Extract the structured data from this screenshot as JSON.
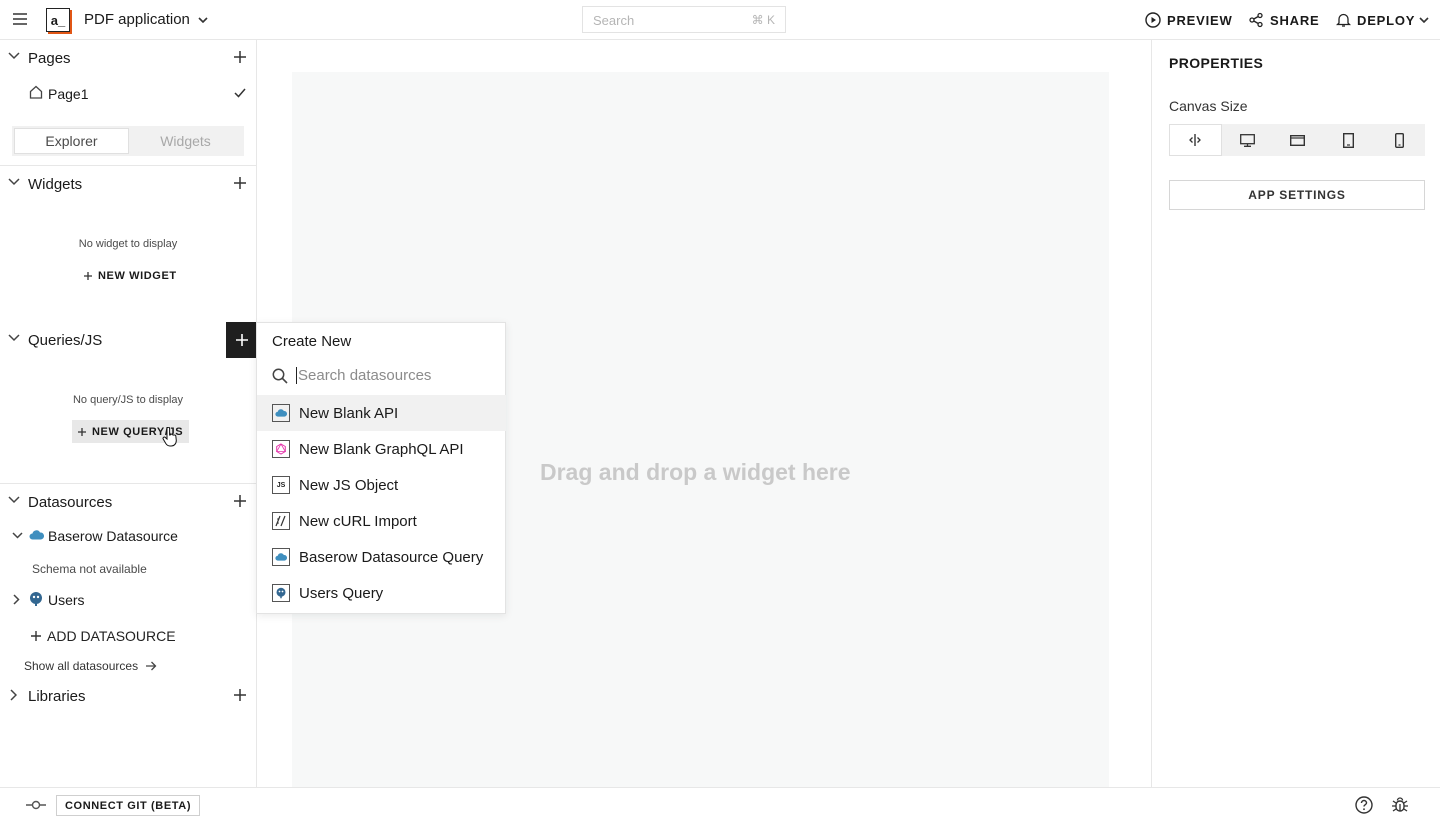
{
  "header": {
    "logo_text": "a_",
    "app_name": "PDF application",
    "search_placeholder": "Search",
    "search_shortcut": "⌘ K",
    "preview": "PREVIEW",
    "share": "SHARE",
    "deploy": "DEPLOY"
  },
  "sidebar": {
    "pages_title": "Pages",
    "page1": "Page1",
    "tab_explorer": "Explorer",
    "tab_widgets": "Widgets",
    "widgets_title": "Widgets",
    "widgets_empty": "No widget to display",
    "new_widget": "NEW WIDGET",
    "queries_title": "Queries/JS",
    "queries_empty": "No query/JS to display",
    "new_query": "NEW QUERY/JS",
    "datasources_title": "Datasources",
    "datasource_baserow": "Baserow Datasource",
    "schema_na": "Schema not available",
    "datasource_users": "Users",
    "add_datasource": "ADD DATASOURCE",
    "show_all": "Show all datasources",
    "libraries_title": "Libraries"
  },
  "canvas": {
    "drop_text": "Drag and drop a widget here"
  },
  "properties": {
    "title": "PROPERTIES",
    "canvas_size": "Canvas Size",
    "app_settings": "APP SETTINGS"
  },
  "create_menu": {
    "title": "Create New",
    "search_placeholder": "Search datasources",
    "items": [
      {
        "label": "New Blank API",
        "icon": "cloud-api-icon"
      },
      {
        "label": "New Blank GraphQL API",
        "icon": "graphql-icon"
      },
      {
        "label": "New JS Object",
        "icon": "js-object-icon"
      },
      {
        "label": "New cURL Import",
        "icon": "curl-icon"
      },
      {
        "label": "Baserow Datasource Query",
        "icon": "cloud-api-icon"
      },
      {
        "label": "Users Query",
        "icon": "postgres-icon"
      }
    ]
  },
  "footer": {
    "connect_git": "CONNECT GIT (BETA)"
  },
  "colors": {
    "brand_accent": "#e15615",
    "dark_button": "#1f1f1f",
    "highlight": "#f1f1f1"
  }
}
